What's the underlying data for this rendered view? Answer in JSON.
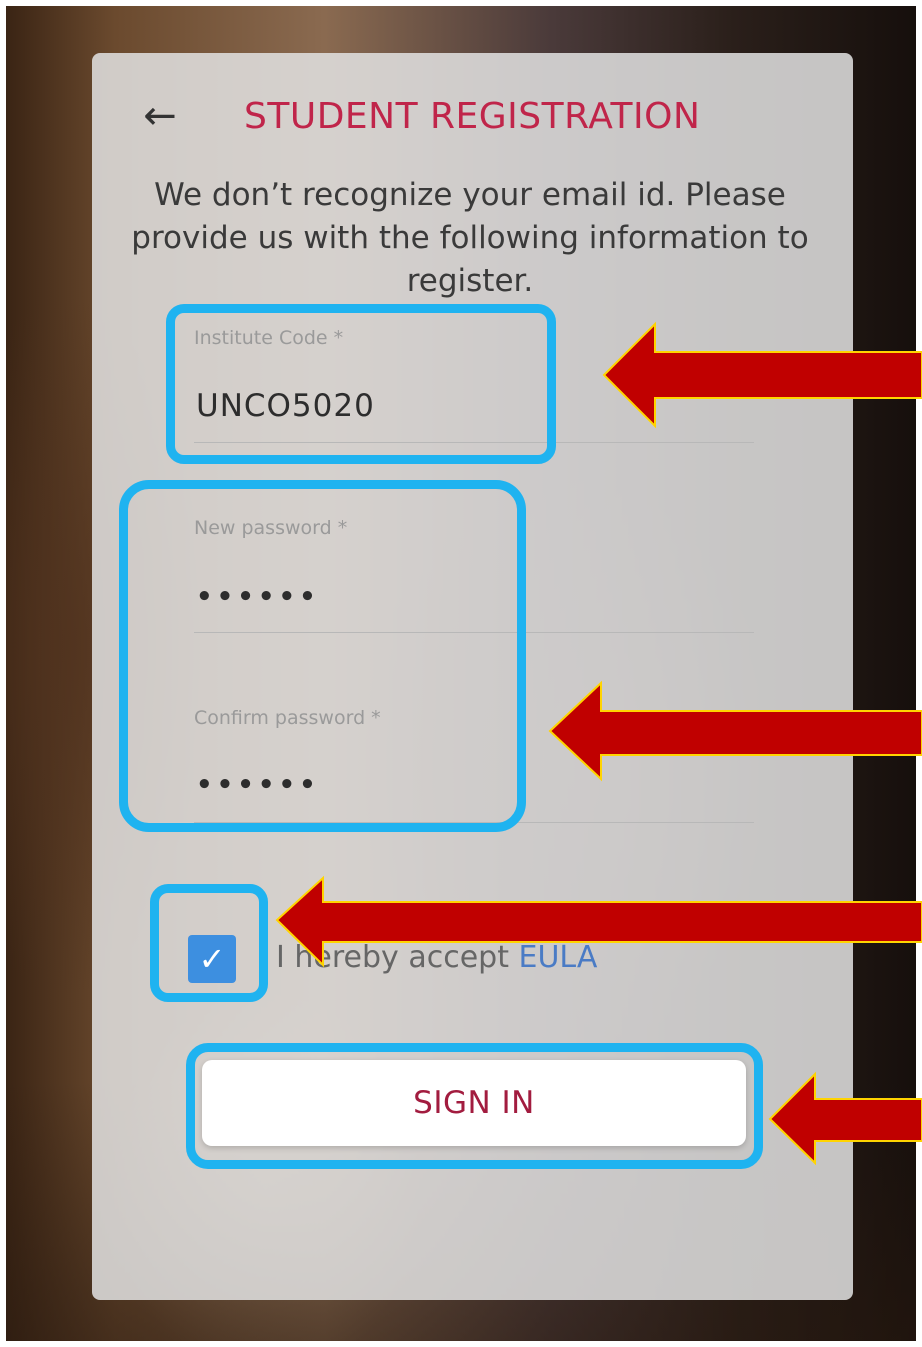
{
  "header": {
    "back_icon": "back-arrow-icon",
    "title": "STUDENT REGISTRATION"
  },
  "intro": {
    "message": "We don’t recognize your email id. Please provide us with the following information to register."
  },
  "form": {
    "institute_code": {
      "label": "Institute Code *",
      "value": "UNCO5020"
    },
    "new_password": {
      "label": "New password *",
      "value": "••••••"
    },
    "confirm_password": {
      "label": "Confirm password *",
      "value": "••••••"
    },
    "eula": {
      "checked": true,
      "text": "I hereby accept",
      "link": "EULA",
      "check_icon": "checkmark-icon"
    },
    "submit_label": "SIGN IN"
  },
  "annotations": {
    "highlight_color": "#1fb3f0",
    "arrow_color": "#c00000",
    "arrow_outline": "#ffd400"
  }
}
